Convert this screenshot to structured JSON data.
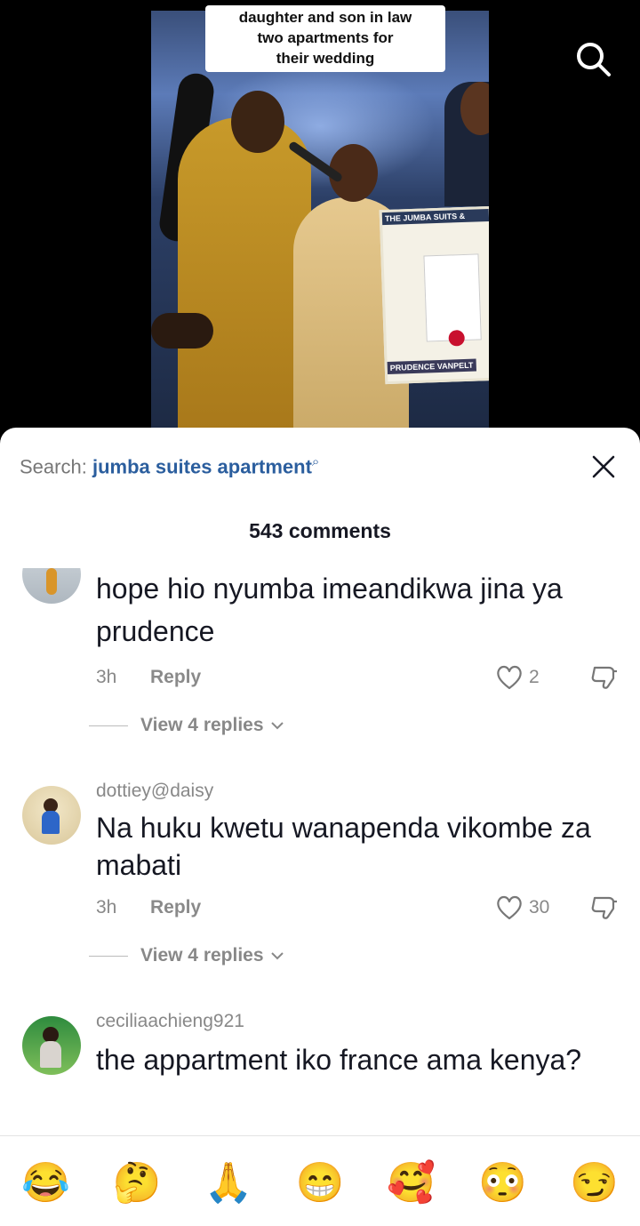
{
  "video": {
    "caption_lines": [
      "daughter and son in law",
      "two apartments for",
      "their wedding"
    ],
    "certificate_header": "THE JUMBA SUITS &",
    "certificate_footer": "PRUDENCE VANPELT"
  },
  "search": {
    "label": "Search:",
    "query": "jumba suites apartment",
    "query_icon": "⌕"
  },
  "comments_count": "543 comments",
  "comments": [
    {
      "user": "",
      "text": "hope hio nyumba imeandikwa jina ya prudence",
      "time": "3h",
      "reply_label": "Reply",
      "likes": "2",
      "view_replies": "View 4 replies"
    },
    {
      "user": "dottiey@daisy",
      "text": "Na huku kwetu wanapenda vikombe za mabati",
      "time": "3h",
      "reply_label": "Reply",
      "likes": "30",
      "view_replies": "View 4 replies"
    },
    {
      "user": "ceciliaachieng921",
      "text": "the appartment iko france ama kenya?",
      "time": "",
      "reply_label": "",
      "likes": "",
      "view_replies": ""
    }
  ],
  "emojis": [
    "😂",
    "🤔",
    "🙏",
    "😁",
    "🥰",
    "😳",
    "😏"
  ],
  "colors": {
    "link_blue": "#2b5e9e",
    "muted": "#888888",
    "text": "#161823"
  }
}
